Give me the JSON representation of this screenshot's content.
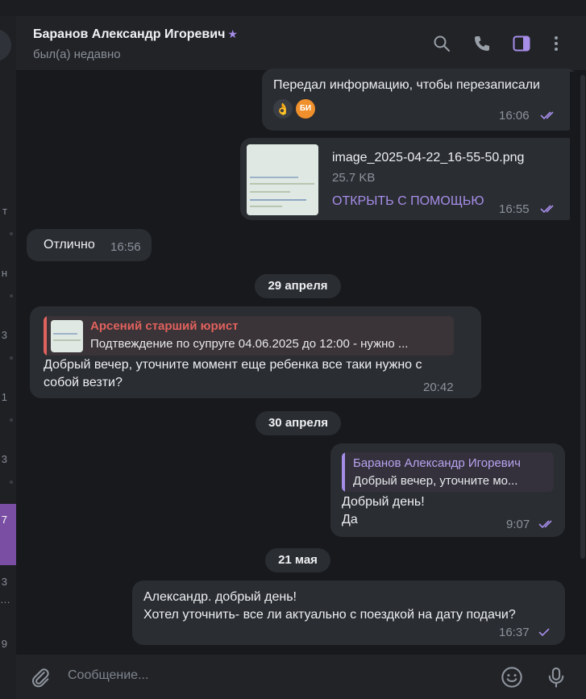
{
  "header": {
    "contact_name": "Баранов Александр Игоревич",
    "star": "★",
    "status": "был(а) недавно",
    "icons": [
      "search-icon",
      "phone-icon",
      "sidebar-toggle-icon",
      "more-vertical-icon"
    ]
  },
  "left_list": {
    "fragments": [
      "т",
      "н",
      "3",
      "1",
      "3",
      "7",
      "3",
      "…",
      "9"
    ]
  },
  "messages": {
    "m1": {
      "text": "Передал информацию, чтобы перезаписали",
      "time": "16:06",
      "reactions": [
        "👌",
        "БИ"
      ]
    },
    "m2": {
      "file_name": "image_2025-04-22_16-55-50.png",
      "file_size": "25.7 KB",
      "action": "ОТКРЫТЬ С ПОМОЩЬЮ",
      "time": "16:55"
    },
    "m3": {
      "text": "Отлично",
      "time": "16:56"
    },
    "date1": "29 апреля",
    "m4": {
      "reply_author": "Арсений старший юрист",
      "reply_text": "Подтвеждение по супруге  04.06.2025 до 12:00 - нужно ...",
      "line1": "Добрый вечер, уточните момент еще ребенка все таки нужно с",
      "line2": "собой везти?",
      "time": "20:42"
    },
    "date2": "30 апреля",
    "m5": {
      "reply_author": "Баранов Александр Игоревич",
      "reply_text": "Добрый вечер, уточните мо...",
      "line1": "Добрый день!",
      "line2": "Да",
      "time": "9:07"
    },
    "date3": "21 мая",
    "m6": {
      "line1": "Александр. добрый день!",
      "line2": "Хотел уточнить- все ли актуально с поездкой на дату подачи?",
      "time": "16:37"
    }
  },
  "composer": {
    "placeholder": "Сообщение...",
    "icons": [
      "attach-icon",
      "emoji-icon",
      "mic-icon"
    ]
  },
  "colors": {
    "accent": "#a68de8",
    "reply_red": "#e0625e",
    "reply_purple": "#a68de8",
    "active_chat": "#7a4fa3"
  }
}
